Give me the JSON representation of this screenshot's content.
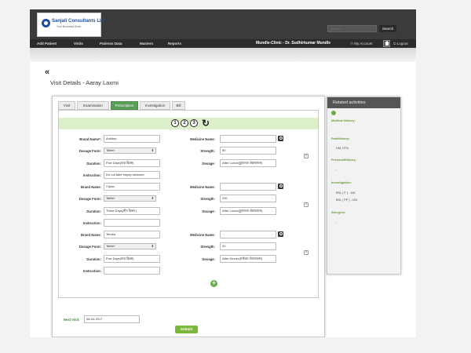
{
  "header": {
    "logo_name": "Sanjali Consultants LLP",
    "logo_tagline": "Your Business Brain",
    "search_placeholder": "Search",
    "search_button": "Search"
  },
  "nav": {
    "items": [
      "Add Patient",
      "Visits",
      "Patients Data",
      "Masters",
      "Reports"
    ],
    "clinic": "Mundle-Clinic - Dr. Sudhirkumar Mundle",
    "my_account": "My Account",
    "logout": "Logout"
  },
  "page": {
    "back_symbol": "«",
    "title": "Visit Details - Aaray Laxmi"
  },
  "tabs": [
    {
      "label": "Visit",
      "active": false
    },
    {
      "label": "Examination",
      "active": false
    },
    {
      "label": "Prescription",
      "active": true
    },
    {
      "label": "Investigation",
      "active": false
    },
    {
      "label": "Bill",
      "active": false
    }
  ],
  "steps": [
    "1",
    "2",
    "3"
  ],
  "labels": {
    "brand_required": "Brand Name*:",
    "brand": "Brand Name:",
    "medicine": "Medicine Name:",
    "dosage_form": "Dosage Form:",
    "strength": "Strength:",
    "duration": "Duration:",
    "dosage": "Dosage:",
    "instruction": "Instruction:"
  },
  "prescriptions": [
    {
      "brand": "Antidep",
      "medicine": "",
      "dosage_form": "Tablet",
      "strength": "50",
      "duration": "Five Days(पाच दिवस)",
      "dosage": "After Lunch(दुपारच्या जेवणानंतर)",
      "instruction": "Do not take empty stomach"
    },
    {
      "brand": "Ciplox",
      "medicine": "",
      "dosage_form": "Tablet",
      "strength": "200",
      "duration": "Three Days(तीन दिवस )",
      "dosage": "After Lunch(दुपारच्या जेवणानंतर)",
      "instruction": ""
    },
    {
      "brand": "Tendia",
      "medicine": "",
      "dosage_form": "Tablet",
      "strength": "20",
      "duration": "Five Days(पाच दिवस)",
      "dosage": "After Dinner(रात्रीच्या जेवणानंतर)",
      "instruction": ""
    }
  ],
  "next_visit": {
    "label": "Next Visit:",
    "value": "08-04-2017"
  },
  "submit_label": "Submit",
  "related": {
    "title": "Related activities",
    "medical_history": "Medical History:",
    "past_history": "PastHistory:",
    "past_history_value": "DM, HTN",
    "personal_history": "PersonalHistory:",
    "personal_history_value": "-",
    "investigation": "Investigation:",
    "investigation_values": [
      "BSL ( F )    :  183",
      "BSL ( PP )  :  204"
    ],
    "allergies": "Allergies:",
    "allergies_value": "-"
  },
  "colors": {
    "nav_bg": "#2b2b2b",
    "active_tab": "#5a9e5a",
    "submit": "#7ab83a",
    "step_bar": "#dceeca"
  }
}
